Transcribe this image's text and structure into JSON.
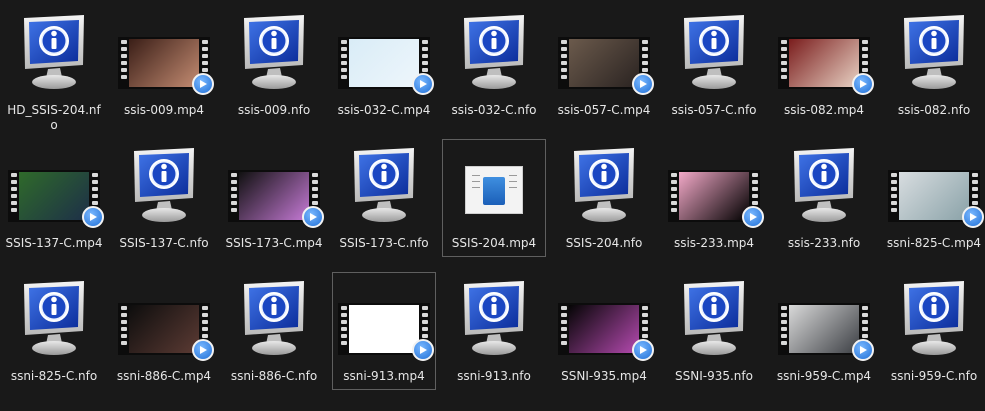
{
  "files": [
    {
      "name": "HD_SSIS-204.nfo",
      "kind": "nfo"
    },
    {
      "name": "ssis-009.mp4",
      "kind": "video",
      "thumb_colors": [
        "#3a1e17",
        "#c48c72"
      ]
    },
    {
      "name": "ssis-009.nfo",
      "kind": "nfo"
    },
    {
      "name": "ssis-032-C.mp4",
      "kind": "video",
      "thumb_colors": [
        "#d9ecf7",
        "#eef6fb"
      ]
    },
    {
      "name": "ssis-032-C.nfo",
      "kind": "nfo"
    },
    {
      "name": "ssis-057-C.mp4",
      "kind": "video",
      "thumb_colors": [
        "#6b5a4c",
        "#2a2321"
      ]
    },
    {
      "name": "ssis-057-C.nfo",
      "kind": "nfo"
    },
    {
      "name": "ssis-082.mp4",
      "kind": "video",
      "thumb_colors": [
        "#7a1d1d",
        "#e8d2c4"
      ]
    },
    {
      "name": "ssis-082.nfo",
      "kind": "nfo"
    },
    {
      "name": "SSIS-137-C.mp4",
      "kind": "video",
      "thumb_colors": [
        "#2f6a2a",
        "#1d2f48"
      ]
    },
    {
      "name": "SSIS-137-C.nfo",
      "kind": "nfo"
    },
    {
      "name": "SSIS-173-C.mp4",
      "kind": "video",
      "thumb_colors": [
        "#111111",
        "#c67ad6"
      ]
    },
    {
      "name": "SSIS-173-C.nfo",
      "kind": "nfo"
    },
    {
      "name": "SSIS-204.mp4",
      "kind": "media",
      "selected": true
    },
    {
      "name": "SSIS-204.nfo",
      "kind": "nfo"
    },
    {
      "name": "ssis-233.mp4",
      "kind": "video",
      "thumb_colors": [
        "#f3a9c8",
        "#000000"
      ]
    },
    {
      "name": "ssis-233.nfo",
      "kind": "nfo"
    },
    {
      "name": "ssni-825-C.mp4",
      "kind": "video",
      "thumb_colors": [
        "#d8dde0",
        "#8aa2a8"
      ]
    },
    {
      "name": "ssni-825-C.nfo",
      "kind": "nfo"
    },
    {
      "name": "ssni-886-C.mp4",
      "kind": "video",
      "thumb_colors": [
        "#0d0d0d",
        "#5c3b34"
      ]
    },
    {
      "name": "ssni-886-C.nfo",
      "kind": "nfo"
    },
    {
      "name": "ssni-913.mp4",
      "kind": "video",
      "thumb_colors": [
        "#ffffff",
        "#ffffff"
      ],
      "selected": true
    },
    {
      "name": "ssni-913.nfo",
      "kind": "nfo"
    },
    {
      "name": "SSNI-935.mp4",
      "kind": "video",
      "thumb_colors": [
        "#050505",
        "#b54ab0"
      ]
    },
    {
      "name": "SSNI-935.nfo",
      "kind": "nfo"
    },
    {
      "name": "ssni-959-C.mp4",
      "kind": "video",
      "thumb_colors": [
        "#d9d9d9",
        "#3c3f44"
      ]
    },
    {
      "name": "ssni-959-C.nfo",
      "kind": "nfo"
    }
  ],
  "icons": {
    "nfo": "info-monitor-icon",
    "video": "video-thumbnail-icon",
    "media": "media-file-icon"
  }
}
